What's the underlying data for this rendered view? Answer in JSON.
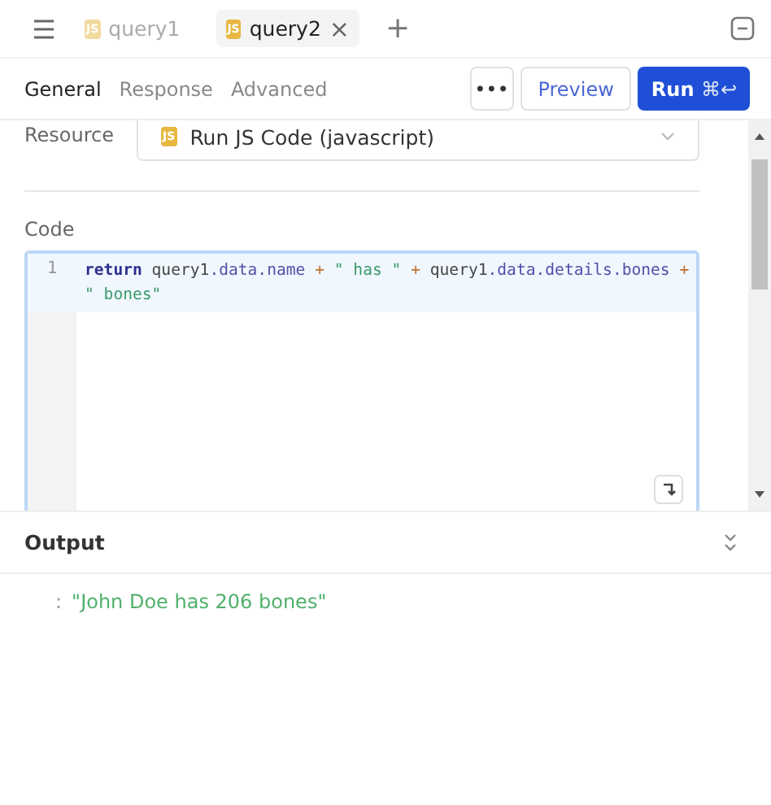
{
  "tabs": [
    {
      "badge": "JS",
      "label": "query1",
      "selected": false,
      "closable": false
    },
    {
      "badge": "JS",
      "label": "query2",
      "selected": true,
      "closable": true
    }
  ],
  "close_glyph": "×",
  "add_glyph": "+",
  "subtabs": [
    {
      "label": "General",
      "selected": true
    },
    {
      "label": "Response",
      "selected": false
    },
    {
      "label": "Advanced",
      "selected": false
    }
  ],
  "more_glyph": "•••",
  "preview_label": "Preview",
  "run_label": "Run",
  "run_shortcut": "⌘↩",
  "resource": {
    "label": "Resource",
    "badge": "JS",
    "value": "Run JS Code (javascript)"
  },
  "code": {
    "label": "Code",
    "lines": [
      {
        "number": "1",
        "tokens": [
          {
            "kind": "keyword",
            "text": "return"
          },
          {
            "kind": "var",
            "text": " query1"
          },
          {
            "kind": "prop",
            "text": ".data.name"
          },
          {
            "kind": "op",
            "text": " + "
          },
          {
            "kind": "string",
            "text": "\" has \""
          },
          {
            "kind": "op",
            "text": " + "
          },
          {
            "kind": "var",
            "text": "query1"
          },
          {
            "kind": "prop",
            "text": ".data.details.bones"
          },
          {
            "kind": "op",
            "text": " + "
          },
          {
            "kind": "string",
            "text": "\" bones\""
          }
        ]
      }
    ]
  },
  "output": {
    "title": "Output",
    "colon": ":",
    "value": "\"John Doe has 206 bones\""
  }
}
